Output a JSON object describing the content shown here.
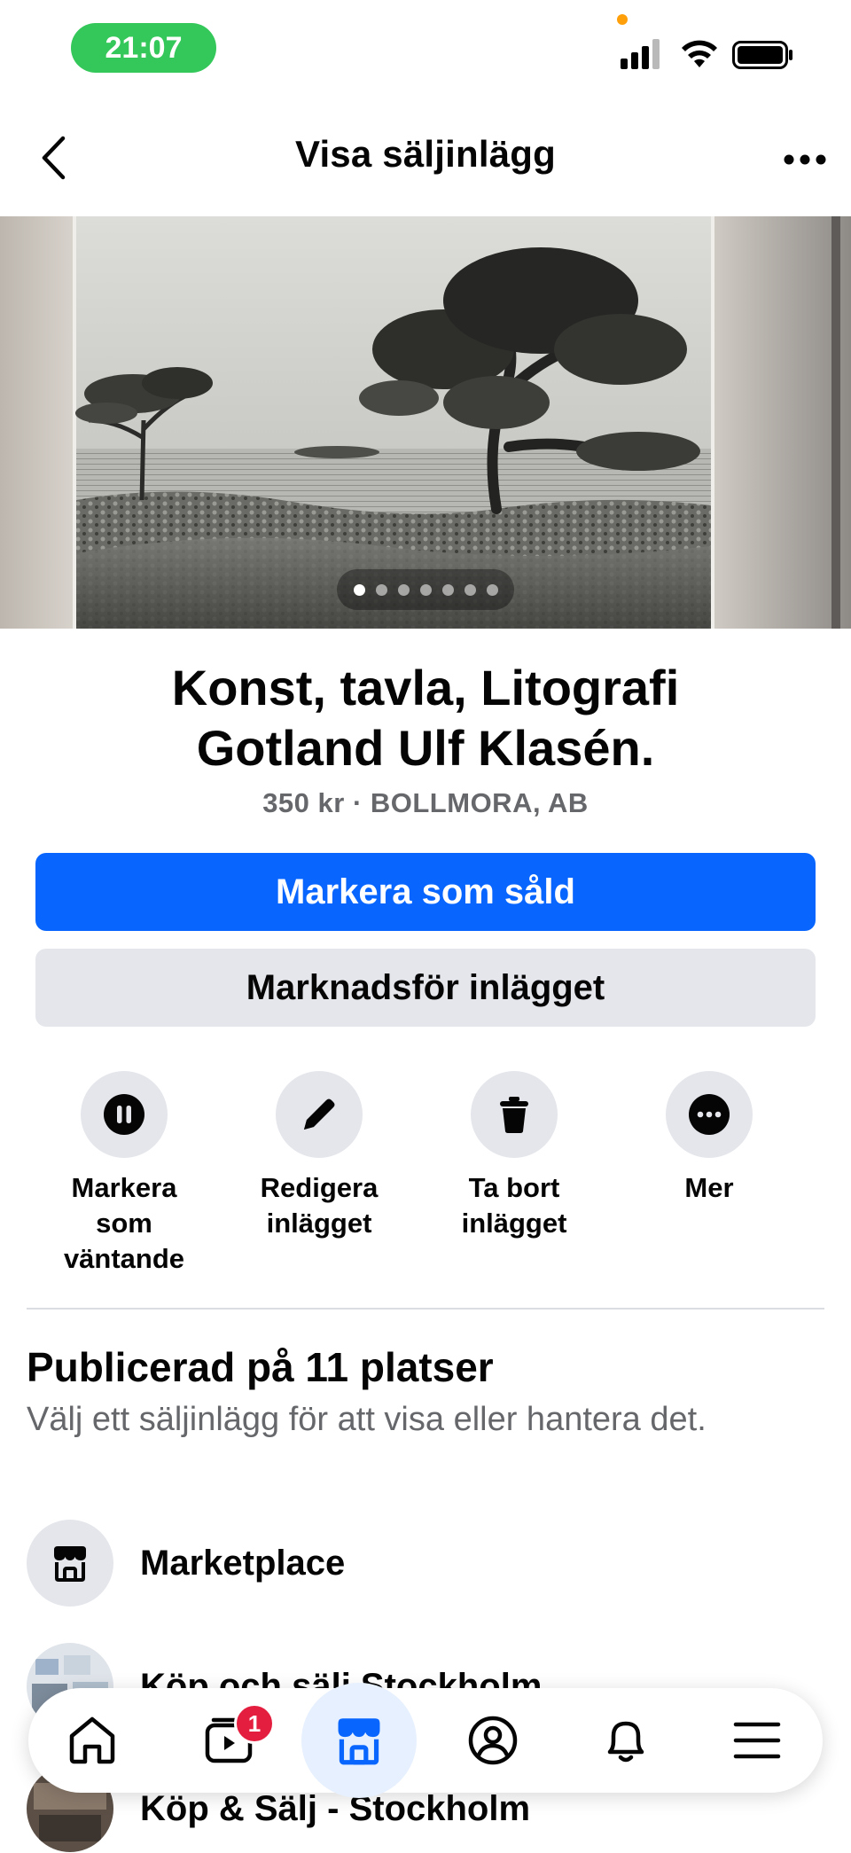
{
  "status_bar": {
    "time": "21:07"
  },
  "header": {
    "title": "Visa säljinlägg"
  },
  "hero": {
    "image_count": 7,
    "active_index": 0
  },
  "listing": {
    "title_line1": "Konst, tavla, Litografi",
    "title_line2": "Gotland Ulf Klasén.",
    "meta": "350 kr · BOLLMORA, AB"
  },
  "buttons": {
    "primary": "Markera som såld",
    "secondary": "Marknadsför inlägget"
  },
  "actions": [
    {
      "label": "Markera\nsom\nväntande",
      "icon": "pause-icon"
    },
    {
      "label": "Redigera\ninlägget",
      "icon": "pencil-icon"
    },
    {
      "label": "Ta bort\ninlägget",
      "icon": "trash-icon"
    },
    {
      "label": "Mer",
      "icon": "more-icon"
    }
  ],
  "published": {
    "title": "Publicerad på 11 platser",
    "subtitle": "Välj ett säljinlägg för att visa eller hantera det.",
    "places": [
      {
        "label": "Marketplace",
        "icon": "store-icon"
      },
      {
        "label": "Köp och sälj Stockholm",
        "icon": "group-thumbnail"
      },
      {
        "label": "Köp & Sälj - Stockholm",
        "icon": "group-thumbnail"
      }
    ]
  },
  "tabbar": {
    "tabs": [
      {
        "name": "home",
        "icon": "home-icon"
      },
      {
        "name": "video",
        "icon": "video-icon",
        "badge": "1"
      },
      {
        "name": "marketplace",
        "icon": "marketplace-icon",
        "active": true
      },
      {
        "name": "profile",
        "icon": "profile-icon"
      },
      {
        "name": "notifications",
        "icon": "bell-icon"
      },
      {
        "name": "menu",
        "icon": "menu-icon"
      }
    ]
  },
  "colors": {
    "primary": "#0866ff",
    "secondary_bg": "#e4e6eb",
    "muted_text": "#65676b",
    "status_green": "#34c759",
    "badge_red": "#e41e3f"
  }
}
